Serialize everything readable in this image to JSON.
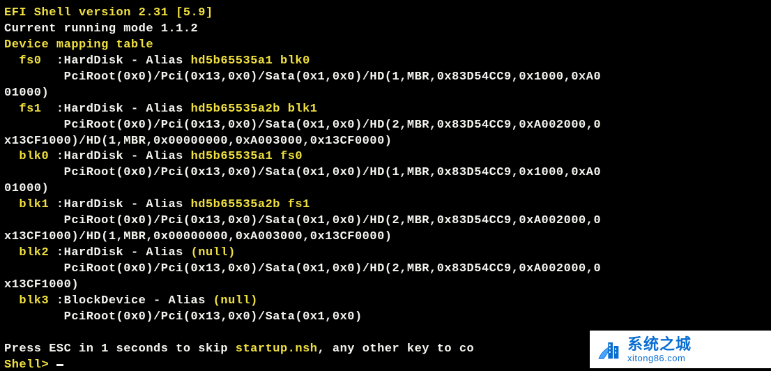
{
  "header": {
    "shell_version_line": "EFI Shell version 2.31 [5.9]",
    "running_mode": "Current running mode 1.1.2",
    "mapping_header": "Device mapping table"
  },
  "entries": [
    {
      "name": "fs0",
      "type": "HardDisk",
      "alias_label": "Alias",
      "alias": "hd5b65535a1 blk0",
      "path_lines": [
        "PciRoot(0x0)/Pci(0x13,0x0)/Sata(0x1,0x0)/HD(1,MBR,0x83D54CC9,0x1000,0xA0",
        "01000)"
      ]
    },
    {
      "name": "fs1",
      "type": "HardDisk",
      "alias_label": "Alias",
      "alias": "hd5b65535a2b blk1",
      "path_lines": [
        "PciRoot(0x0)/Pci(0x13,0x0)/Sata(0x1,0x0)/HD(2,MBR,0x83D54CC9,0xA002000,0",
        "x13CF1000)/HD(1,MBR,0x00000000,0xA003000,0x13CF0000)"
      ]
    },
    {
      "name": "blk0",
      "type": "HardDisk",
      "alias_label": "Alias",
      "alias": "hd5b65535a1 fs0",
      "path_lines": [
        "PciRoot(0x0)/Pci(0x13,0x0)/Sata(0x1,0x0)/HD(1,MBR,0x83D54CC9,0x1000,0xA0",
        "01000)"
      ]
    },
    {
      "name": "blk1",
      "type": "HardDisk",
      "alias_label": "Alias",
      "alias": "hd5b65535a2b fs1",
      "path_lines": [
        "PciRoot(0x0)/Pci(0x13,0x0)/Sata(0x1,0x0)/HD(2,MBR,0x83D54CC9,0xA002000,0",
        "x13CF1000)/HD(1,MBR,0x00000000,0xA003000,0x13CF0000)"
      ]
    },
    {
      "name": "blk2",
      "type": "HardDisk",
      "alias_label": "Alias",
      "alias": "(null)",
      "path_lines": [
        "PciRoot(0x0)/Pci(0x13,0x0)/Sata(0x1,0x0)/HD(2,MBR,0x83D54CC9,0xA002000,0",
        "x13CF1000)"
      ]
    },
    {
      "name": "blk3",
      "type": "BlockDevice",
      "alias_label": "Alias",
      "alias": "(null)",
      "path_lines": [
        "PciRoot(0x0)/Pci(0x13,0x0)/Sata(0x1,0x0)"
      ]
    }
  ],
  "footer": {
    "press_esc_prefix": "Press ESC in 1 seconds to skip ",
    "startup_file": "startup.nsh",
    "press_esc_suffix": ", any other key to co",
    "prompt": "Shell> "
  },
  "watermark": {
    "title": "系统之城",
    "url": "xitong86.com"
  }
}
